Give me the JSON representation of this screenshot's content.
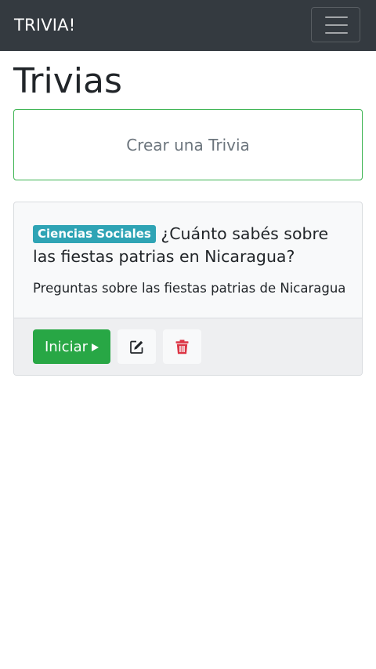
{
  "navbar": {
    "brand": "TRIVIA!",
    "toggler_icon": "hamburger-menu-icon"
  },
  "page": {
    "title": "Trivias",
    "create_label": "Crear una Trivia"
  },
  "trivias": [
    {
      "category": "Ciencias Sociales",
      "title": "¿Cuánto sabés sobre las fiestas patrias en Nicaragua?",
      "description": "Preguntas sobre las fiestas patrias de Nicaragua",
      "start_label": "Iniciar",
      "start_icon": "play-icon",
      "edit_icon": "edit-icon",
      "delete_icon": "trash-icon"
    }
  ],
  "colors": {
    "navbar": "#343a40",
    "success": "#28a745",
    "info_badge": "#2fa4b5",
    "danger": "#dc3545"
  }
}
